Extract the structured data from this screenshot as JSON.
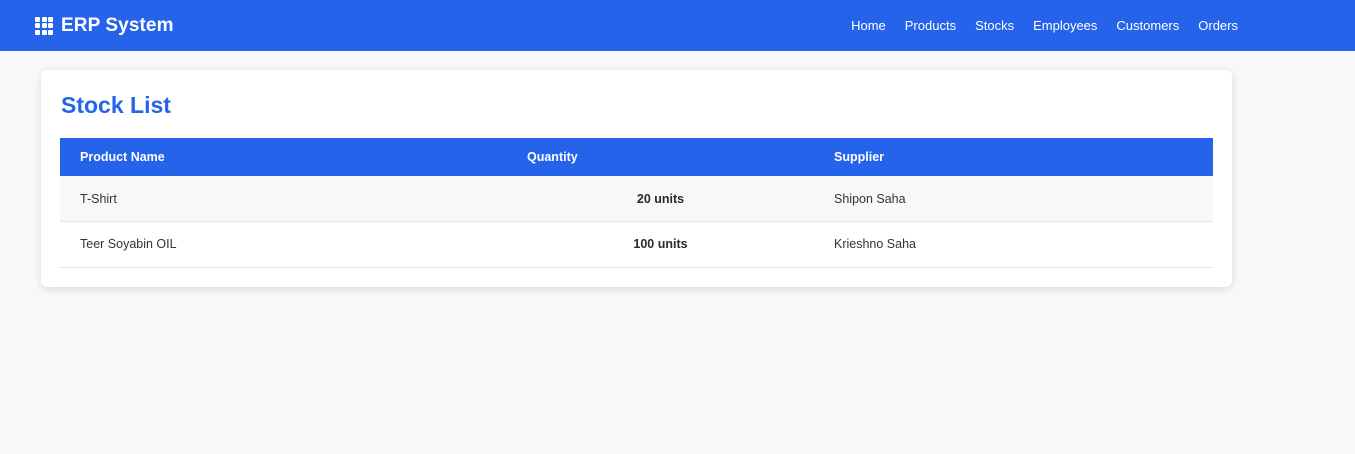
{
  "navbar": {
    "brand": "ERP System",
    "brand_icon": "grid-icon",
    "links": [
      {
        "label": "Home"
      },
      {
        "label": "Products"
      },
      {
        "label": "Stocks"
      },
      {
        "label": "Employees"
      },
      {
        "label": "Customers"
      },
      {
        "label": "Orders"
      }
    ]
  },
  "page": {
    "title": "Stock List"
  },
  "table": {
    "headers": [
      "Product Name",
      "Quantity",
      "Supplier"
    ],
    "rows": [
      {
        "product": "T-Shirt",
        "quantity": "20 units",
        "supplier": "Shipon Saha"
      },
      {
        "product": "Teer Soyabin OIL",
        "quantity": "100 units",
        "supplier": "Krieshno Saha"
      }
    ]
  },
  "colors": {
    "primary": "#2563eb",
    "background": "#f7f8fa",
    "card": "#ffffff"
  }
}
